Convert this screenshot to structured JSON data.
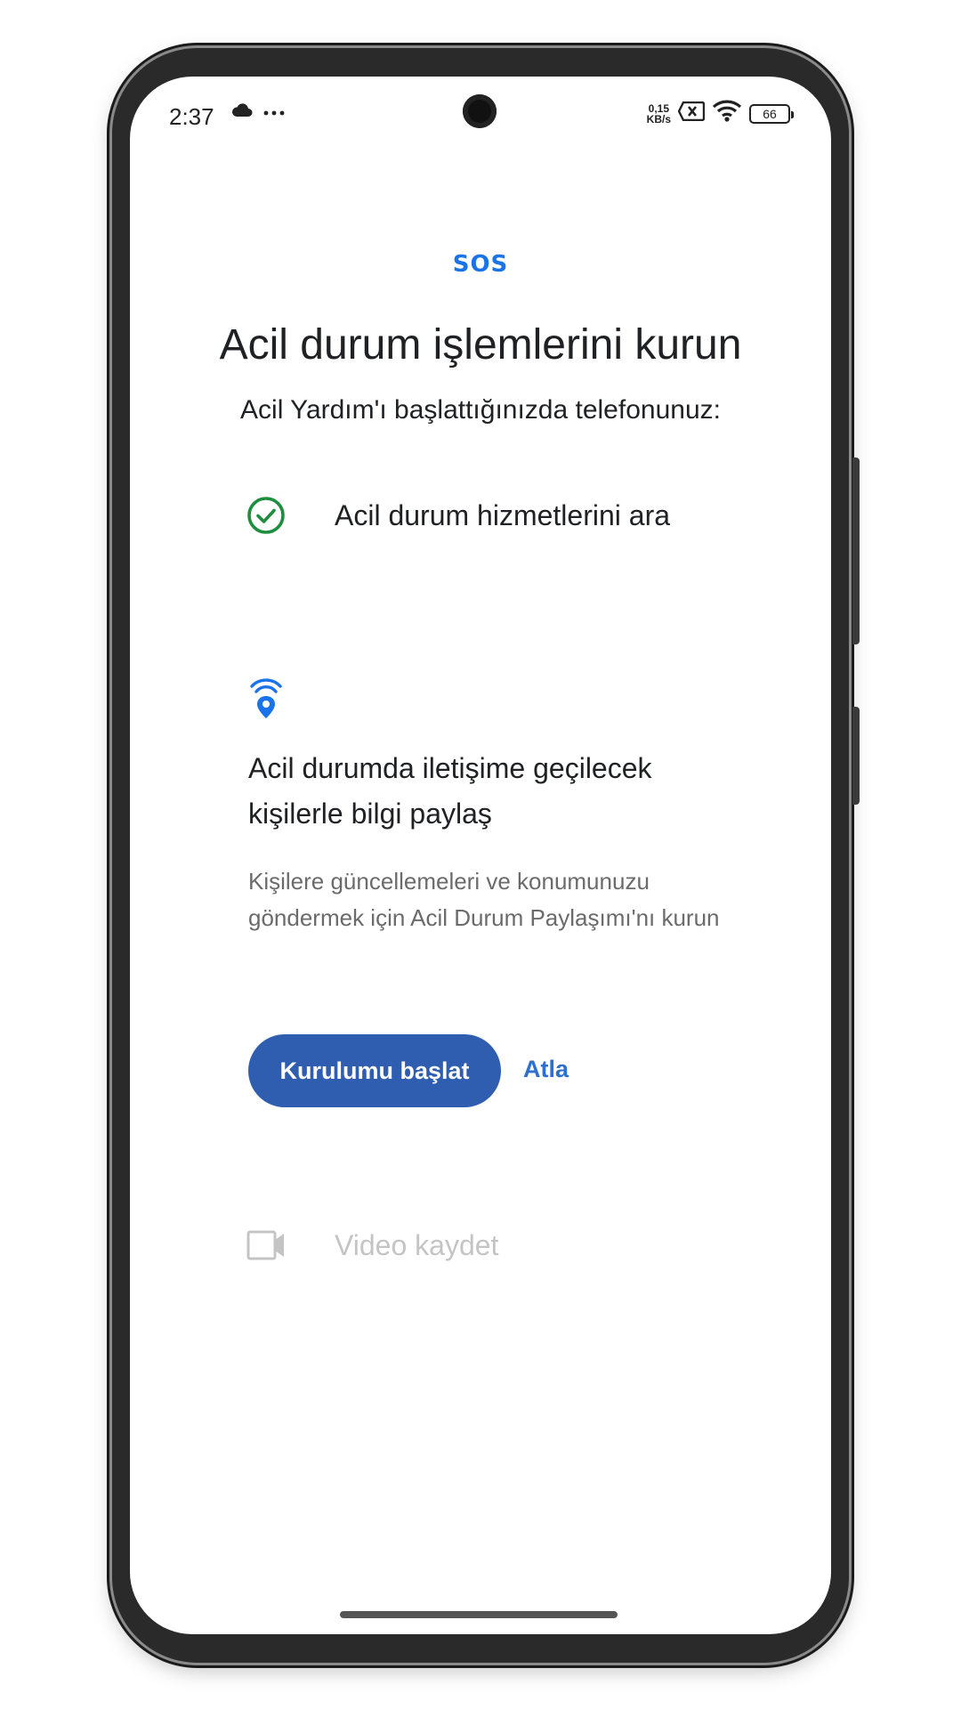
{
  "status_bar": {
    "time": "2:37",
    "netspeed_value": "0,15",
    "netspeed_unit": "KB/s",
    "battery": "66",
    "icons": [
      "cloud-icon",
      "more-dots-icon",
      "sim-x-icon",
      "wifi-icon",
      "battery-icon"
    ]
  },
  "header": {
    "sos_label": "SOS",
    "title": "Acil durum işlemlerini kurun",
    "subtitle": "Acil Yardım'ı başlattığınızda telefonunuz:"
  },
  "actions": {
    "call_services": {
      "label": "Acil durum hizmetlerini ara",
      "icon": "check-circle-icon",
      "color": "#1e8e3e"
    },
    "share_info": {
      "title": "Acil durumda iletişime geçilecek kişilerle bilgi paylaş",
      "description": "Kişilere güncellemeleri ve konumunuzu göndermek için Acil Durum Paylaşımı'nı kurun",
      "icon": "location-broadcast-icon",
      "setup_button": "Kurulumu başlat",
      "skip_link": "Atla"
    },
    "record_video": {
      "label": "Video kaydet",
      "icon": "video-camera-icon"
    }
  },
  "colors": {
    "accent_blue": "#1a73e8",
    "button_blue": "#2f5eb0",
    "green": "#1e8e3e"
  }
}
